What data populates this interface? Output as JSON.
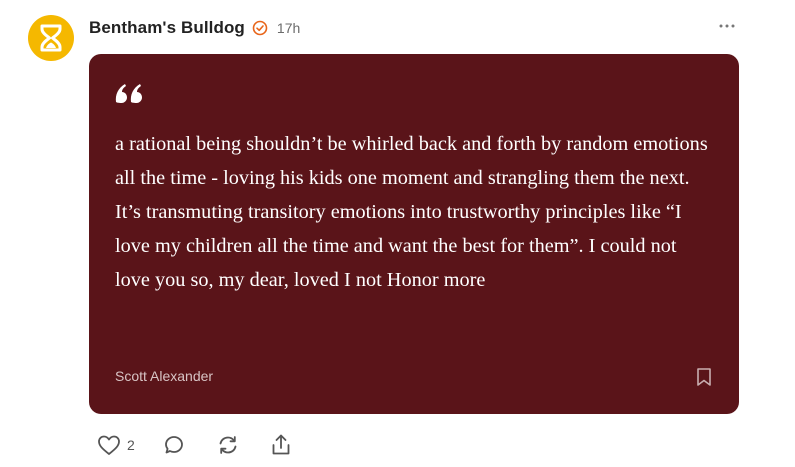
{
  "post": {
    "author": "Bentham's Bulldog",
    "time": "17h",
    "avatar_icon": "hourglass-icon",
    "verified_icon": "verified-badge-icon",
    "accent_color": "#f5b800",
    "verified_color": "#e8651a"
  },
  "quote": {
    "text": "a rational being shouldn’t be whirled back and forth by random emotions all the time - loving his kids one moment and strangling them the next. It’s transmuting transitory emotions into trustworthy principles like “I love my children all the time and want the best for them”. I could not love you so, my dear, loved I not Honor more",
    "attribution": "Scott Alexander",
    "card_color": "#5a1419",
    "text_color": "#ffffff"
  },
  "actions": {
    "like_count": "2",
    "icons": [
      "heart-icon",
      "comment-icon",
      "restack-icon",
      "share-icon"
    ]
  }
}
